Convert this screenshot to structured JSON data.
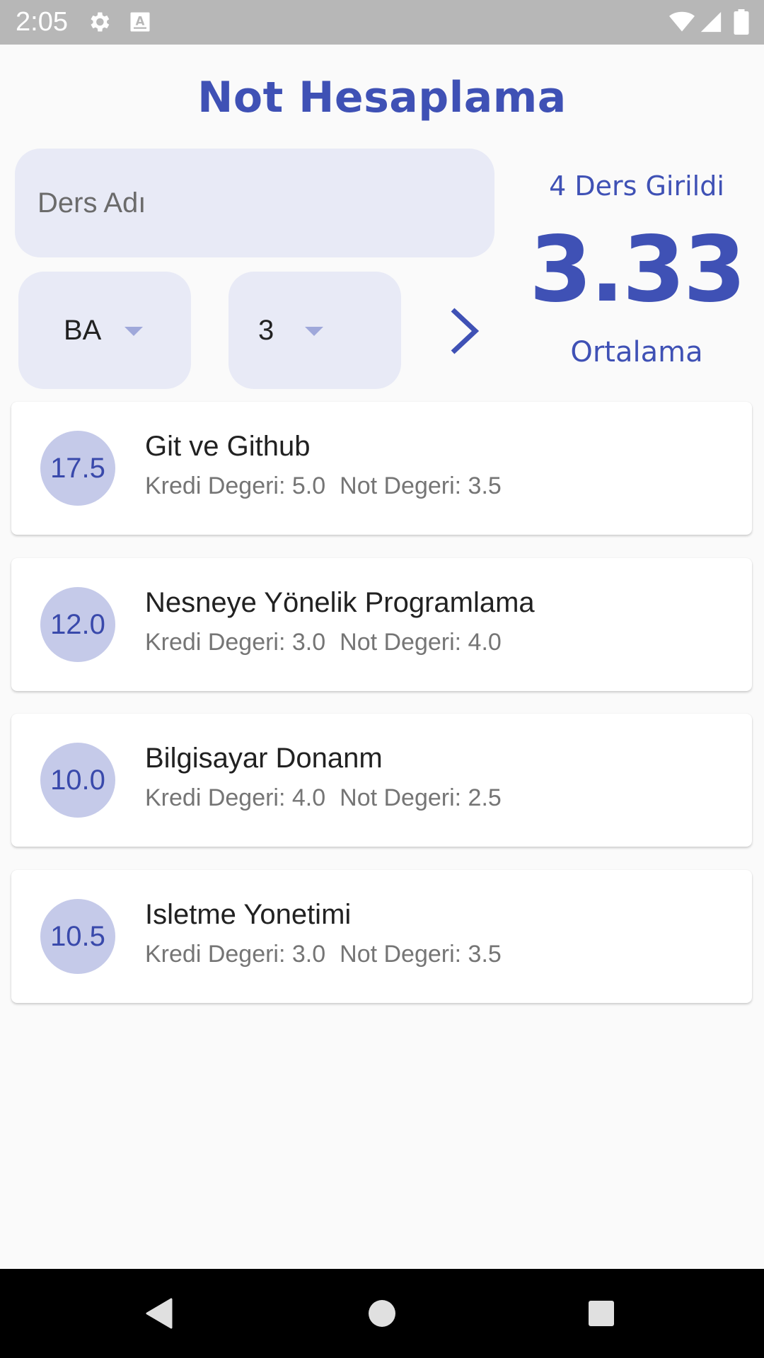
{
  "status_bar": {
    "time": "2:05",
    "icons": [
      "gear-icon",
      "keyboard-a-icon",
      "wifi-icon",
      "signal-icon",
      "battery-icon"
    ]
  },
  "header": {
    "title": "Not Hesaplama"
  },
  "form": {
    "name_placeholder": "Ders Adı",
    "grade_value": "BA",
    "credit_value": "3",
    "add_icon": "chevron-right-icon"
  },
  "summary": {
    "count_label": "4 Ders Girildi",
    "average": "3.33",
    "average_label": "Ortalama"
  },
  "courses": [
    {
      "score": "17.5",
      "name": "Git ve Github",
      "credit": "Kredi Degeri: 5.0",
      "grade": "Not Degeri: 3.5"
    },
    {
      "score": "12.0",
      "name": "Nesneye Yönelik Programlama",
      "credit": "Kredi Degeri: 3.0",
      "grade": "Not Degeri: 4.0"
    },
    {
      "score": "10.0",
      "name": "Bilgisayar Donanm",
      "credit": "Kredi Degeri: 4.0",
      "grade": "Not Degeri: 2.5"
    },
    {
      "score": "10.5",
      "name": "Isletme Yonetimi",
      "credit": "Kredi Degeri: 3.0",
      "grade": "Not Degeri: 3.5"
    }
  ],
  "nav": {
    "icons": [
      "back-icon",
      "home-icon",
      "recents-icon"
    ]
  },
  "colors": {
    "accent": "#3f51b5",
    "field_bg": "#e8eaf6",
    "avatar_bg": "#c5cae9"
  }
}
